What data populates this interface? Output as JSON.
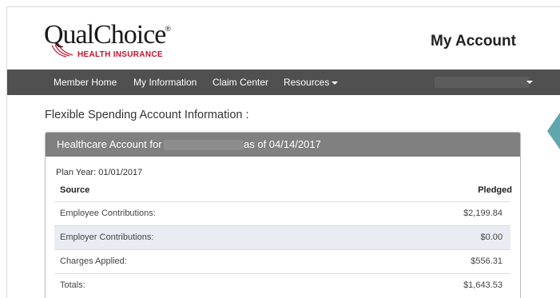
{
  "brand": {
    "logo_text": "QualChoice",
    "registered_mark": "®",
    "logo_subtitle": "HEALTH INSURANCE",
    "color_red": "#c4122f"
  },
  "header": {
    "page_title": "My Account"
  },
  "nav": {
    "items": [
      {
        "label": "Member Home"
      },
      {
        "label": "My Information"
      },
      {
        "label": "Claim Center"
      },
      {
        "label": "Resources"
      }
    ],
    "bg_color": "#505050"
  },
  "fsa": {
    "title": "Flexible Spending Account Information :",
    "panel": {
      "account_label": "Healthcare Account for",
      "as_of": "as of 04/14/2017",
      "plan_year": "Plan Year: 01/01/2017",
      "columns": [
        "Source",
        "Pledged"
      ],
      "rows": [
        {
          "source": "Employee Contributions:",
          "pledged": "$2,199.84"
        },
        {
          "source": "Employer Contributions:",
          "pledged": "$0.00"
        },
        {
          "source": "Charges Applied:",
          "pledged": "$556.31"
        },
        {
          "source": "Totals:",
          "pledged": "$1,643.53"
        }
      ]
    }
  },
  "accent_color": "#5fa6ad"
}
